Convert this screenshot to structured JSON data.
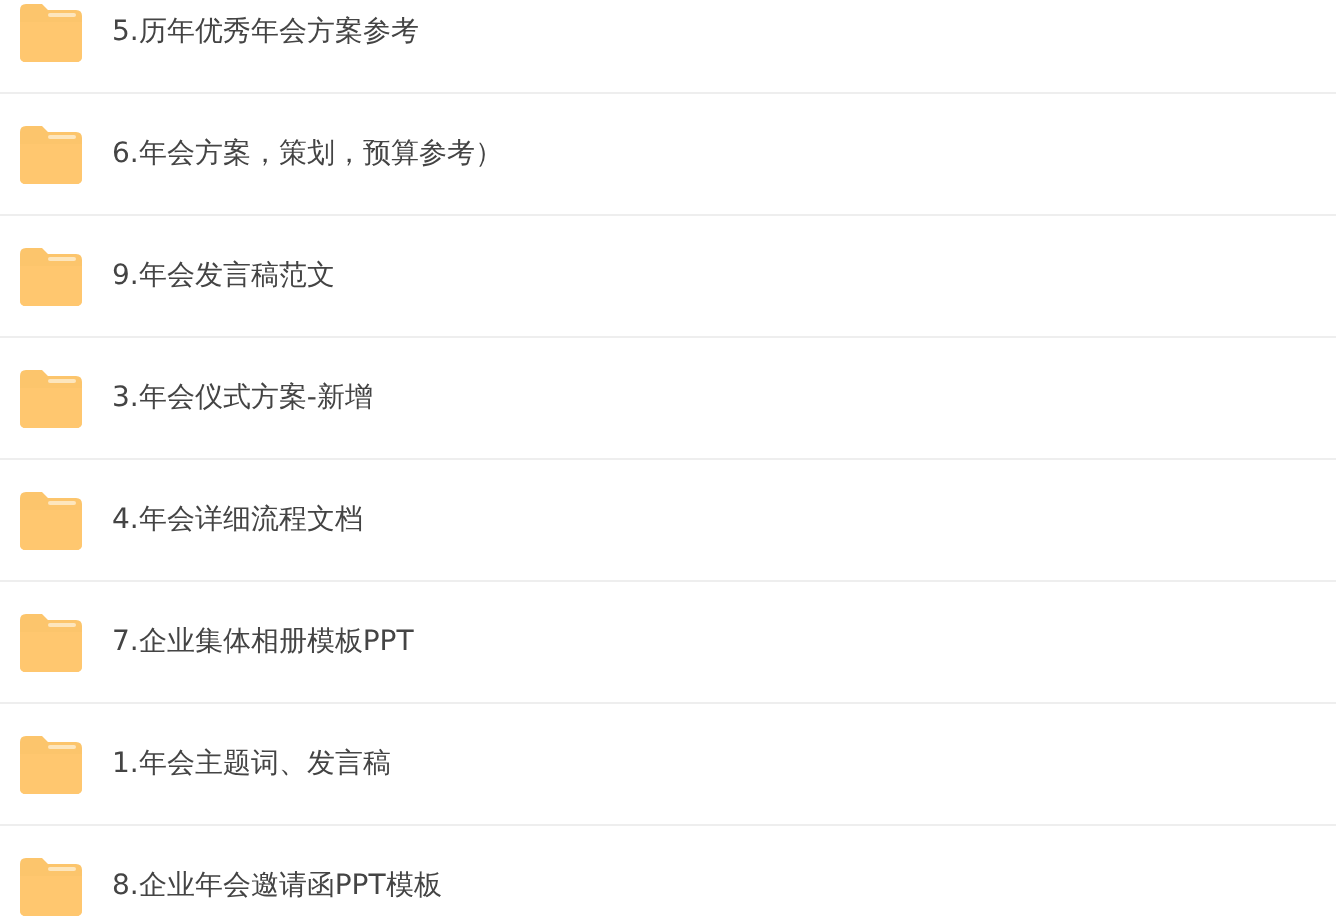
{
  "folders": [
    {
      "name": "5.历年优秀年会方案参考"
    },
    {
      "name": "6.年会方案，策划，预算参考）"
    },
    {
      "name": "9.年会发言稿范文"
    },
    {
      "name": "3.年会仪式方案-新增"
    },
    {
      "name": "4.年会详细流程文档"
    },
    {
      "name": "7.企业集体相册模板PPT"
    },
    {
      "name": "1.年会主题词、发言稿"
    },
    {
      "name": "8.企业年会邀请函PPT模板"
    }
  ]
}
